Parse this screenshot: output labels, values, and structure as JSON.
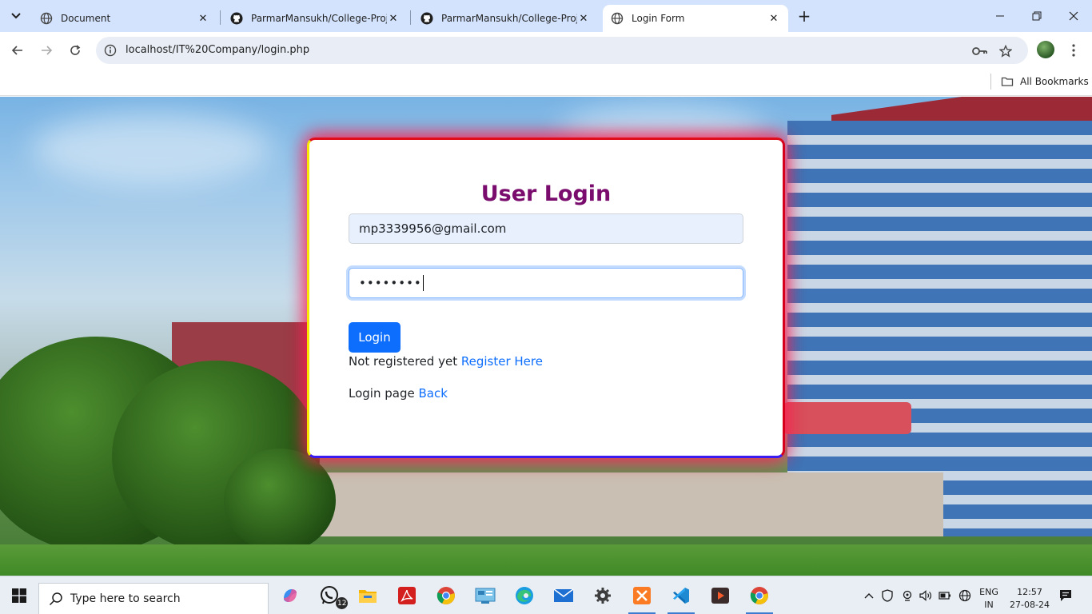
{
  "browser": {
    "tabs": [
      {
        "title": "Document",
        "favicon": "globe-icon",
        "active": false
      },
      {
        "title": "ParmarMansukh/College-Projects",
        "favicon": "github-icon",
        "active": false
      },
      {
        "title": "ParmarMansukh/College-Projects",
        "favicon": "github-icon",
        "active": false
      },
      {
        "title": "Login Form",
        "favicon": "globe-icon",
        "active": true
      }
    ],
    "url": "localhost/IT%20Company/login.php",
    "bookmarks_label": "All Bookmarks"
  },
  "login": {
    "title": "User Login",
    "email_value": "mp3339956@gmail.com",
    "password_masked": "••••••••",
    "login_label": "Login",
    "register_text": "Not registered yet",
    "register_link": "Register Here",
    "back_text": "Login page",
    "back_link": "Back"
  },
  "taskbar": {
    "search_placeholder": "Type here to search",
    "whatsapp_badge": "12",
    "lang_line1": "ENG",
    "lang_line2": "IN",
    "time": "12:57",
    "date": "27-08-24"
  },
  "colors": {
    "title_purple": "#7a0c6e",
    "primary_blue": "#0d6efd",
    "tabstrip": "#d3e3fd"
  }
}
